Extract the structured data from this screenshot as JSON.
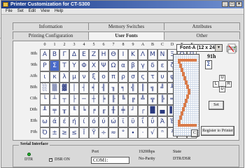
{
  "window": {
    "title": "Printer Customization for CT-S300"
  },
  "menu": [
    "File",
    "Set",
    "Edit",
    "View",
    "Help"
  ],
  "tabs_top": [
    "Information",
    "Memory Switches",
    "Attributes"
  ],
  "tabs_bottom": [
    "Printing Configuration",
    "User Fonts",
    "Other"
  ],
  "active_tab": "User Fonts",
  "grid": {
    "col_headers": [
      "0",
      "1",
      "2",
      "3",
      "4",
      "5",
      "6",
      "7",
      "8",
      "9",
      "A",
      "B",
      "C",
      "D",
      "E",
      "F"
    ],
    "row_labels": [
      "80h",
      "90h",
      "A0h",
      "B0h",
      "C0h",
      "D0h",
      "E0h",
      "F0h"
    ],
    "rows": [
      [
        "Α",
        "Β",
        "Γ",
        "Δ",
        "Ε",
        "Ζ",
        "Η",
        "Θ",
        "Ι",
        "Κ",
        "Λ",
        "Μ",
        "Ν",
        "Ξ",
        "Ο",
        "Π"
      ],
      [
        "Ρ",
        "Σ",
        "Τ",
        "Υ",
        "Φ",
        "Χ",
        "Ψ",
        "Ω",
        "α",
        "β",
        "γ",
        "δ",
        "ε",
        "ζ",
        "η",
        "θ"
      ],
      [
        "ι",
        "κ",
        "λ",
        "μ",
        "ν",
        "ξ",
        "ο",
        "π",
        "ρ",
        "σ",
        "ς",
        "τ",
        "υ",
        "φ",
        "χ",
        "ψ"
      ],
      [
        "░",
        "▒",
        "▓",
        "│",
        "┤",
        "╡",
        "╢",
        "╖",
        "╕",
        "╣",
        "║",
        "╗",
        "╝",
        "╜",
        "╛",
        "┐"
      ],
      [
        "└",
        "┴",
        "┬",
        "├",
        "─",
        "┼",
        "╞",
        "╟",
        "╚",
        "╔",
        "╩",
        "╦",
        "╠",
        "═",
        "╬",
        "╧"
      ],
      [
        "╨",
        "╤",
        "╥",
        "╙",
        "╘",
        "╒",
        "╓",
        "╫",
        "╪",
        "┘",
        "┌",
        "█",
        "▄",
        "▌",
        "▐",
        "▀"
      ],
      [
        "ω",
        "ά",
        "έ",
        "ή",
        "ί",
        "ό",
        "ύ",
        "ώ",
        "ϊ",
        "ϋ",
        "ΐ",
        "ΰ",
        "Ά",
        "Έ",
        "Ή",
        "Ί"
      ],
      [
        "Ό",
        "±",
        "≥",
        "≤",
        "Ϊ",
        "Ϋ",
        "÷",
        "≈",
        "°",
        "∙",
        "·",
        "√",
        "ⁿ",
        "²",
        "■",
        " "
      ]
    ],
    "selected": "91h"
  },
  "font_select": {
    "value": "Font-A (12 x 24)"
  },
  "current_code": "91h",
  "current_char": "Σ",
  "nav": {
    "left": "L",
    "up": "U",
    "right": "R",
    "down": "D"
  },
  "buttons": {
    "set": "Set",
    "clear": "C",
    "register": "Register to Printer"
  },
  "serial": {
    "title": "Serial Interface",
    "dtr": "DTR",
    "dsr": "DSR ON",
    "port_label": "Port",
    "port": "COM1:",
    "baud": "19200bps",
    "parity": "No-Parity",
    "state_label": "State",
    "state": "DTR/DSR"
  },
  "colors": {
    "title_start": "#1c3d8c",
    "glyph": "#2a3a80",
    "selected": "#4a6ac9",
    "pixel": "#d97b4a",
    "led": "#1fb02c"
  }
}
